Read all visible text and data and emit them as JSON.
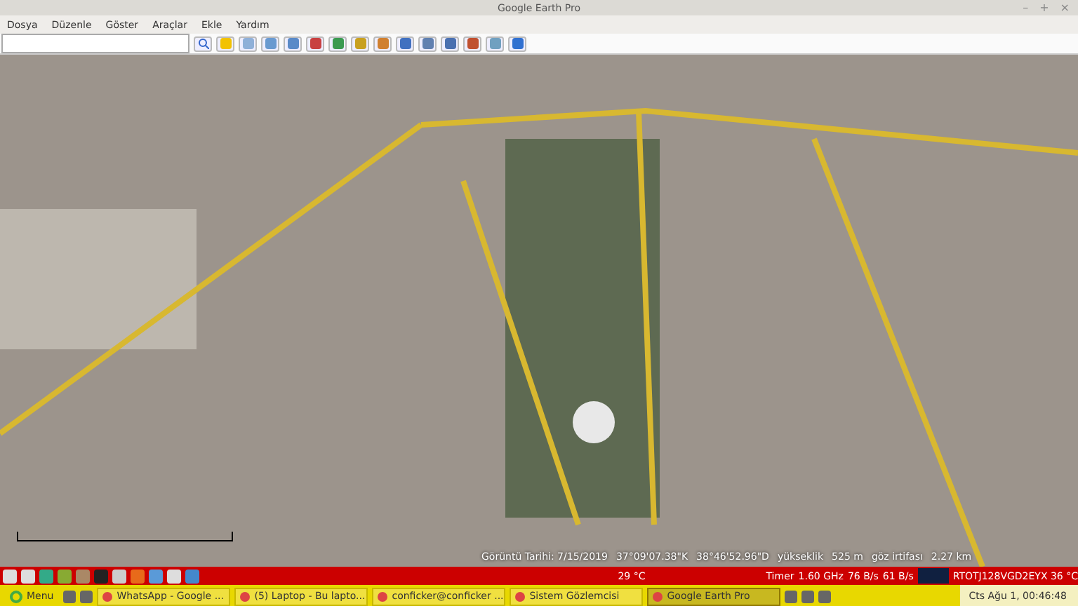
{
  "window": {
    "title": "Google Earth Pro",
    "controls": [
      "–",
      "+",
      "×"
    ]
  },
  "menu": [
    "Dosya",
    "Düzenle",
    "Göster",
    "Araçlar",
    "Ekle",
    "Yardım"
  ],
  "status_overlay": [
    "Görüntü Tarihi: 7/15/2019",
    "37°09'07.38\"K",
    "38°46'52.96\"D",
    "yükseklik",
    "525 m",
    "göz irtifası",
    "2.27 km"
  ],
  "top_panel": {
    "weather": "29 °C",
    "timer": "Timer",
    "cpu": "1.60 GHz",
    "download": "76 B/s",
    "upload": "61 B/s",
    "sensor": "RTOTJ128VGD2EYX 36 °C"
  },
  "taskbar": {
    "menu": "Menu",
    "windows": [
      {
        "label": "WhatsApp - Google ...",
        "selected": false
      },
      {
        "label": "(5) Laptop - Bu lapto...",
        "selected": false
      },
      {
        "label": "conficker@conficker ...",
        "selected": false
      },
      {
        "label": "Sistem Gözlemcisi",
        "selected": false
      },
      {
        "label": "Google Earth Pro",
        "selected": true
      }
    ],
    "clock": "Cts Ağu 1, 00:46:48"
  }
}
